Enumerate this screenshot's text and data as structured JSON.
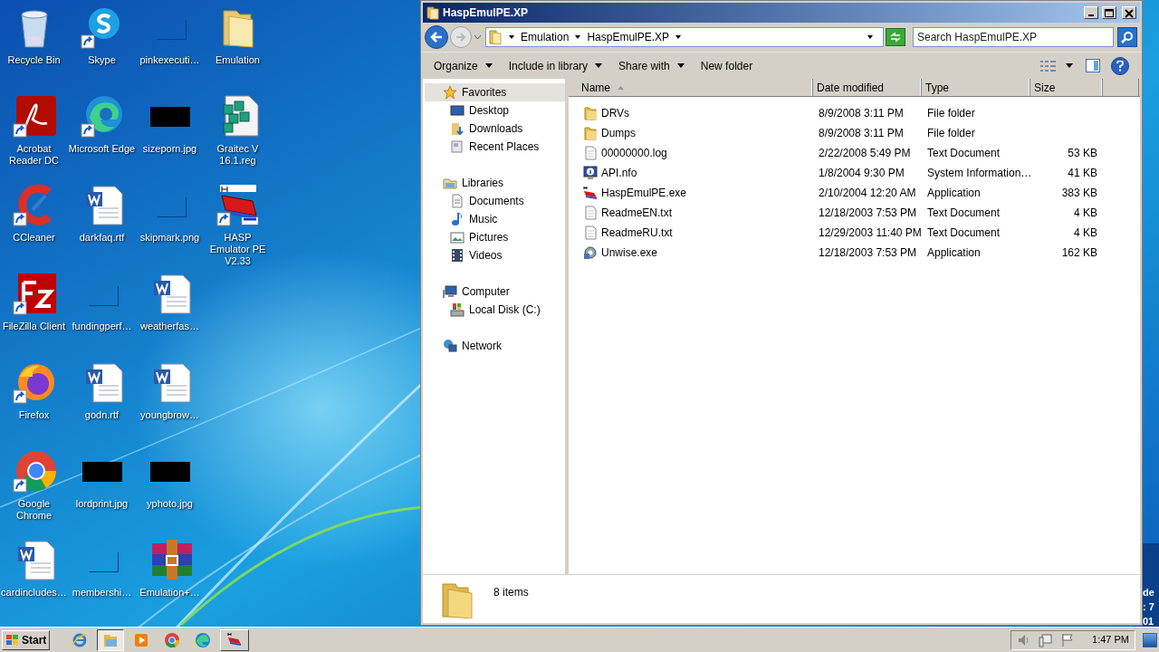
{
  "desktop": {
    "icon_columns": [
      [
        {
          "label": "Recycle Bin",
          "kind": "recycle",
          "shortcut": false
        },
        {
          "label": "Acrobat Reader DC",
          "kind": "acrobat",
          "shortcut": true
        },
        {
          "label": "CCleaner",
          "kind": "ccleaner",
          "shortcut": true
        },
        {
          "label": "FileZilla Client",
          "kind": "filezilla",
          "shortcut": true
        },
        {
          "label": "Firefox",
          "kind": "firefox",
          "shortcut": true
        },
        {
          "label": "Google Chrome",
          "kind": "chrome",
          "shortcut": true
        },
        {
          "label": "cardincludes…",
          "kind": "word",
          "shortcut": false
        }
      ],
      [
        {
          "label": "Skype",
          "kind": "skype",
          "shortcut": true
        },
        {
          "label": "Microsoft Edge",
          "kind": "edge",
          "shortcut": true
        },
        {
          "label": "darkfaq.rtf",
          "kind": "word",
          "shortcut": false
        },
        {
          "label": "fundingperf…",
          "kind": "blank",
          "shortcut": false
        },
        {
          "label": "godn.rtf",
          "kind": "word",
          "shortcut": false
        },
        {
          "label": "lordprint.jpg",
          "kind": "thumb",
          "shortcut": false
        },
        {
          "label": "membershi…",
          "kind": "blank",
          "shortcut": false
        }
      ],
      [
        {
          "label": "pinkexecuti…",
          "kind": "blank",
          "shortcut": false
        },
        {
          "label": "sizeporn.jpg",
          "kind": "thumb",
          "shortcut": false
        },
        {
          "label": "skipmark.png",
          "kind": "blank",
          "shortcut": false
        },
        {
          "label": "weatherfas…",
          "kind": "word",
          "shortcut": false
        },
        {
          "label": "youngbrow…",
          "kind": "word",
          "shortcut": false
        },
        {
          "label": "yphoto.jpg",
          "kind": "thumb",
          "shortcut": false
        },
        {
          "label": "Emulation+…",
          "kind": "archive",
          "shortcut": false
        }
      ],
      [
        {
          "label": "Emulation",
          "kind": "folder",
          "shortcut": false
        },
        {
          "label": "Graitec V 16.1.reg",
          "kind": "registry",
          "shortcut": false
        },
        {
          "label": "HASP Emulator PE V2.33",
          "kind": "hasp",
          "shortcut": true
        }
      ]
    ],
    "edge_text": [
      "de",
      ": 7",
      "01"
    ]
  },
  "window": {
    "title": "HaspEmulPE.XP",
    "breadcrumb": [
      "Emulation",
      "HaspEmulPE.XP"
    ],
    "search": {
      "placeholder": "Search HaspEmulPE.XP"
    },
    "toolbar": [
      {
        "label": "Organize",
        "dropdown": true
      },
      {
        "label": "Include in library",
        "dropdown": true
      },
      {
        "label": "Share with",
        "dropdown": true
      },
      {
        "label": "New folder",
        "dropdown": false
      }
    ],
    "nav": [
      {
        "label": "Favorites",
        "kind": "star",
        "selected": true,
        "children": [
          {
            "label": "Desktop",
            "kind": "desktop",
            "selected": false
          },
          {
            "label": "Downloads",
            "kind": "downloads",
            "selected": false
          },
          {
            "label": "Recent Places",
            "kind": "recent",
            "selected": false
          }
        ]
      },
      {
        "label": "Libraries",
        "kind": "libraries",
        "selected": false,
        "children": [
          {
            "label": "Documents",
            "kind": "documents",
            "selected": false
          },
          {
            "label": "Music",
            "kind": "music",
            "selected": false
          },
          {
            "label": "Pictures",
            "kind": "pictures",
            "selected": false
          },
          {
            "label": "Videos",
            "kind": "videos",
            "selected": false
          }
        ]
      },
      {
        "label": "Computer",
        "kind": "computer",
        "selected": false,
        "children": [
          {
            "label": "Local Disk (C:)",
            "kind": "disk",
            "selected": false
          }
        ]
      },
      {
        "label": "Network",
        "kind": "network",
        "selected": false
      }
    ],
    "columns": [
      {
        "label": "Name",
        "sorted": true
      },
      {
        "label": "Date modified",
        "sorted": false
      },
      {
        "label": "Type",
        "sorted": false
      },
      {
        "label": "Size",
        "sorted": false
      }
    ],
    "files": [
      {
        "name": "DRVs",
        "kind": "folder",
        "date": "8/9/2008 3:11 PM",
        "type": "File folder"
      },
      {
        "name": "Dumps",
        "kind": "folder",
        "date": "8/9/2008 3:11 PM",
        "type": "File folder"
      },
      {
        "name": "00000000.log",
        "kind": "text",
        "date": "2/22/2008 5:49 PM",
        "type": "Text Document",
        "size": "53 KB"
      },
      {
        "name": "API.nfo",
        "kind": "info",
        "date": "1/8/2004 9:30 PM",
        "type": "System Information…",
        "size": "41 KB"
      },
      {
        "name": "HaspEmulPE.exe",
        "kind": "hasp",
        "date": "2/10/2004 12:20 AM",
        "type": "Application",
        "size": "383 KB"
      },
      {
        "name": "ReadmeEN.txt",
        "kind": "text",
        "date": "12/18/2003 7:53 PM",
        "type": "Text Document",
        "size": "4 KB"
      },
      {
        "name": "ReadmeRU.txt",
        "kind": "text",
        "date": "12/29/2003 11:40 PM",
        "type": "Text Document",
        "size": "4 KB"
      },
      {
        "name": "Unwise.exe",
        "kind": "setup",
        "date": "12/18/2003 7:53 PM",
        "type": "Application",
        "size": "162 KB"
      }
    ],
    "status": "8 items"
  },
  "taskbar": {
    "start": "Start",
    "items": [
      {
        "kind": "ie",
        "active": false
      },
      {
        "kind": "explorer",
        "active": true
      },
      {
        "kind": "media",
        "active": false
      },
      {
        "kind": "chrome",
        "active": false
      },
      {
        "kind": "edge",
        "active": false
      },
      {
        "kind": "hasp",
        "active": false
      }
    ],
    "clock": "1:47 PM"
  }
}
